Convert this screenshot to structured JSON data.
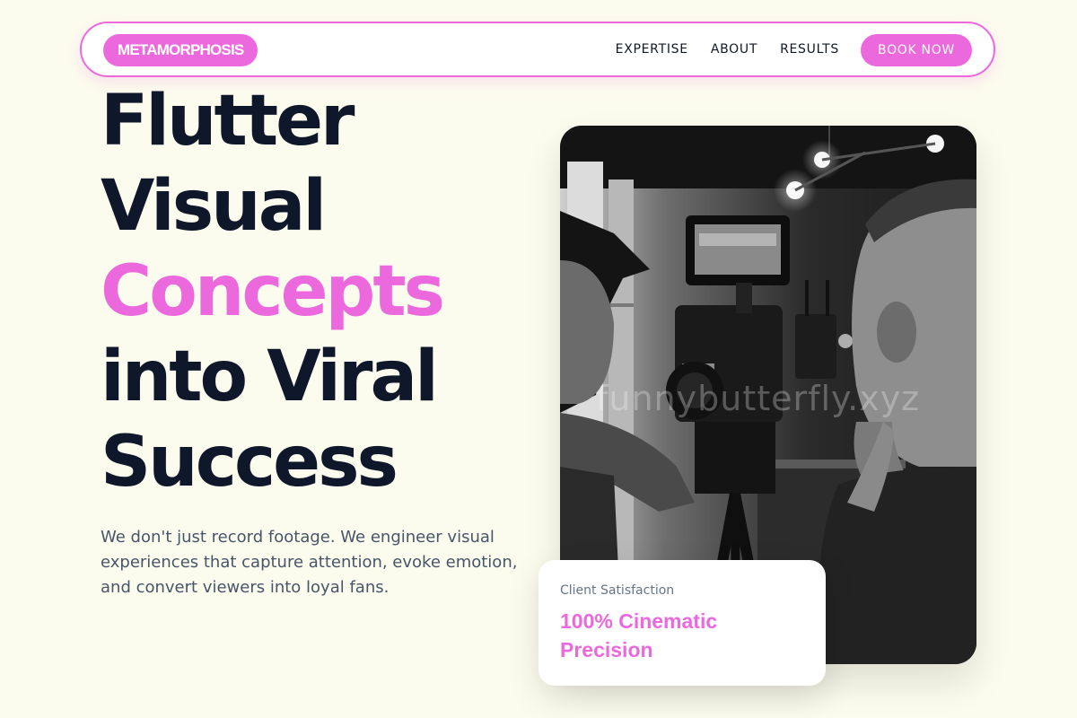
{
  "nav": {
    "logo": "METAMORPHOSIS",
    "links": [
      "EXPERTISE",
      "ABOUT",
      "RESULTS"
    ],
    "cta": "BOOK NOW"
  },
  "hero": {
    "headline_lines": [
      "Flutter",
      "Visual",
      "Concepts",
      "into Viral",
      "Success"
    ],
    "subtext": "We don't just record footage. We engineer visual experiences that capture attention, evoke emotion, and convert viewers into loyal fans."
  },
  "media": {
    "watermark": "funnybutterfly.xyz"
  },
  "stat_card": {
    "label": "Client Satisfaction",
    "value": "100% Cinematic Precision"
  },
  "colors": {
    "accent": "#ec69dd",
    "background": "#fcfcee",
    "heading": "#0f172a",
    "body_text": "#475569"
  }
}
